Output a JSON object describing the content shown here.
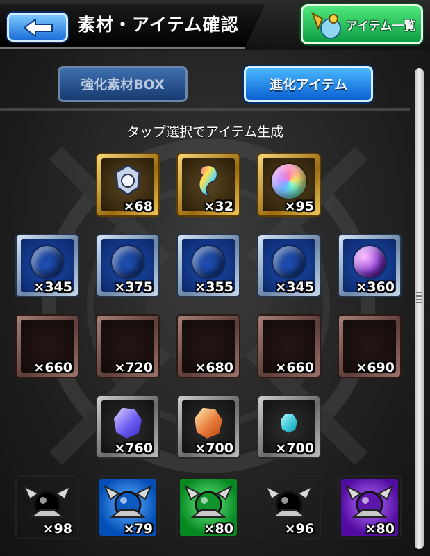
{
  "header": {
    "title": "素材・アイテム確認",
    "back_icon": "back-arrow-icon",
    "list_button_label": "アイテム一覧"
  },
  "tabs": [
    {
      "label": "強化素材BOX",
      "selected": false
    },
    {
      "label": "進化アイテム",
      "selected": true
    }
  ],
  "hint": "タップ選択でアイテム生成",
  "colors": {
    "gold": "#c9a13a",
    "blue": "#1e4fb3",
    "brown": "#6b4a43",
    "silver": "#8a8a8a",
    "tab_active": "#1f86f0",
    "green_button": "#1cc356"
  },
  "rows": [
    {
      "frame": "gold",
      "items": [
        {
          "icon": "helmet-crest-icon",
          "qty": "×68"
        },
        {
          "icon": "rainbow-swirl-icon",
          "qty": "×32"
        },
        {
          "icon": "rainbow-orb-icon",
          "qty": "×95"
        }
      ]
    },
    {
      "frame": "blue",
      "items": [
        {
          "icon": "fire-orb-icon",
          "color": "#e0331c",
          "qty": "×345"
        },
        {
          "icon": "water-orb-icon",
          "color": "#2f84e8",
          "qty": "×375"
        },
        {
          "icon": "wood-orb-icon",
          "color": "#2cb52e",
          "qty": "×355"
        },
        {
          "icon": "light-orb-icon",
          "color": "#f1d31c",
          "qty": "×345"
        },
        {
          "icon": "dark-orb-icon",
          "color": "#8b3fd6",
          "qty": "×360"
        }
      ]
    },
    {
      "frame": "brown",
      "items": [
        {
          "icon": "fire-stone-icon",
          "color": "#e63a1d",
          "qty": "×660"
        },
        {
          "icon": "water-stone-icon",
          "color": "#2b8bf0",
          "qty": "×720"
        },
        {
          "icon": "wood-stone-icon",
          "color": "#33b93a",
          "qty": "×680"
        },
        {
          "icon": "light-stone-icon",
          "color": "#f3d51d",
          "qty": "×660"
        },
        {
          "icon": "dark-stone-icon",
          "color": "#9a3ee0",
          "qty": "×690"
        }
      ]
    },
    {
      "frame": "silver",
      "items": [
        {
          "icon": "violet-crystal-icon",
          "color": "#6a5cf0",
          "qty": "×760"
        },
        {
          "icon": "orange-crystal-icon",
          "color": "#e8793a",
          "qty": "×700"
        },
        {
          "icon": "cyan-crystal-icon",
          "color": "#3fc6d8",
          "qty": "×700"
        }
      ]
    },
    {
      "frame": "char",
      "items": [
        {
          "icon": "fire-dragon-icon",
          "color": "#d8281c",
          "qty": "×98"
        },
        {
          "icon": "water-dragon-icon",
          "color": "#2a77e0",
          "qty": "×79"
        },
        {
          "icon": "wood-dragon-icon",
          "color": "#2fb14a",
          "qty": "×80"
        },
        {
          "icon": "light-dragon-icon",
          "color": "#f2a81c",
          "qty": "×96"
        },
        {
          "icon": "dark-dragon-icon",
          "color": "#7a34c8",
          "qty": "×80"
        }
      ]
    }
  ]
}
